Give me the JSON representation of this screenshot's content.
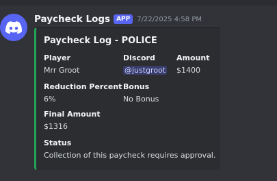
{
  "message": {
    "username": "Paycheck Logs",
    "app_tag": "APP",
    "timestamp": "7/22/2025 4:58 PM"
  },
  "embed": {
    "accent_color": "#23a559",
    "title": "Paycheck Log - POLICE",
    "fields": {
      "player": {
        "name": "Player",
        "value": "Mrr Groot"
      },
      "discord": {
        "name": "Discord",
        "value": "@justgroot"
      },
      "amount": {
        "name": "Amount",
        "value": "$1400"
      },
      "reduction": {
        "name": "Reduction Percent",
        "value": "6%"
      },
      "bonus": {
        "name": "Bonus",
        "value": "No Bonus"
      },
      "final_amount": {
        "name": "Final Amount",
        "value": "$1316"
      },
      "status": {
        "name": "Status",
        "value": "Collection of this paycheck requires approval."
      }
    }
  },
  "icons": {
    "avatar": "discord-logo-icon"
  },
  "colors": {
    "background": "#313338",
    "brand": "#5865f2"
  }
}
